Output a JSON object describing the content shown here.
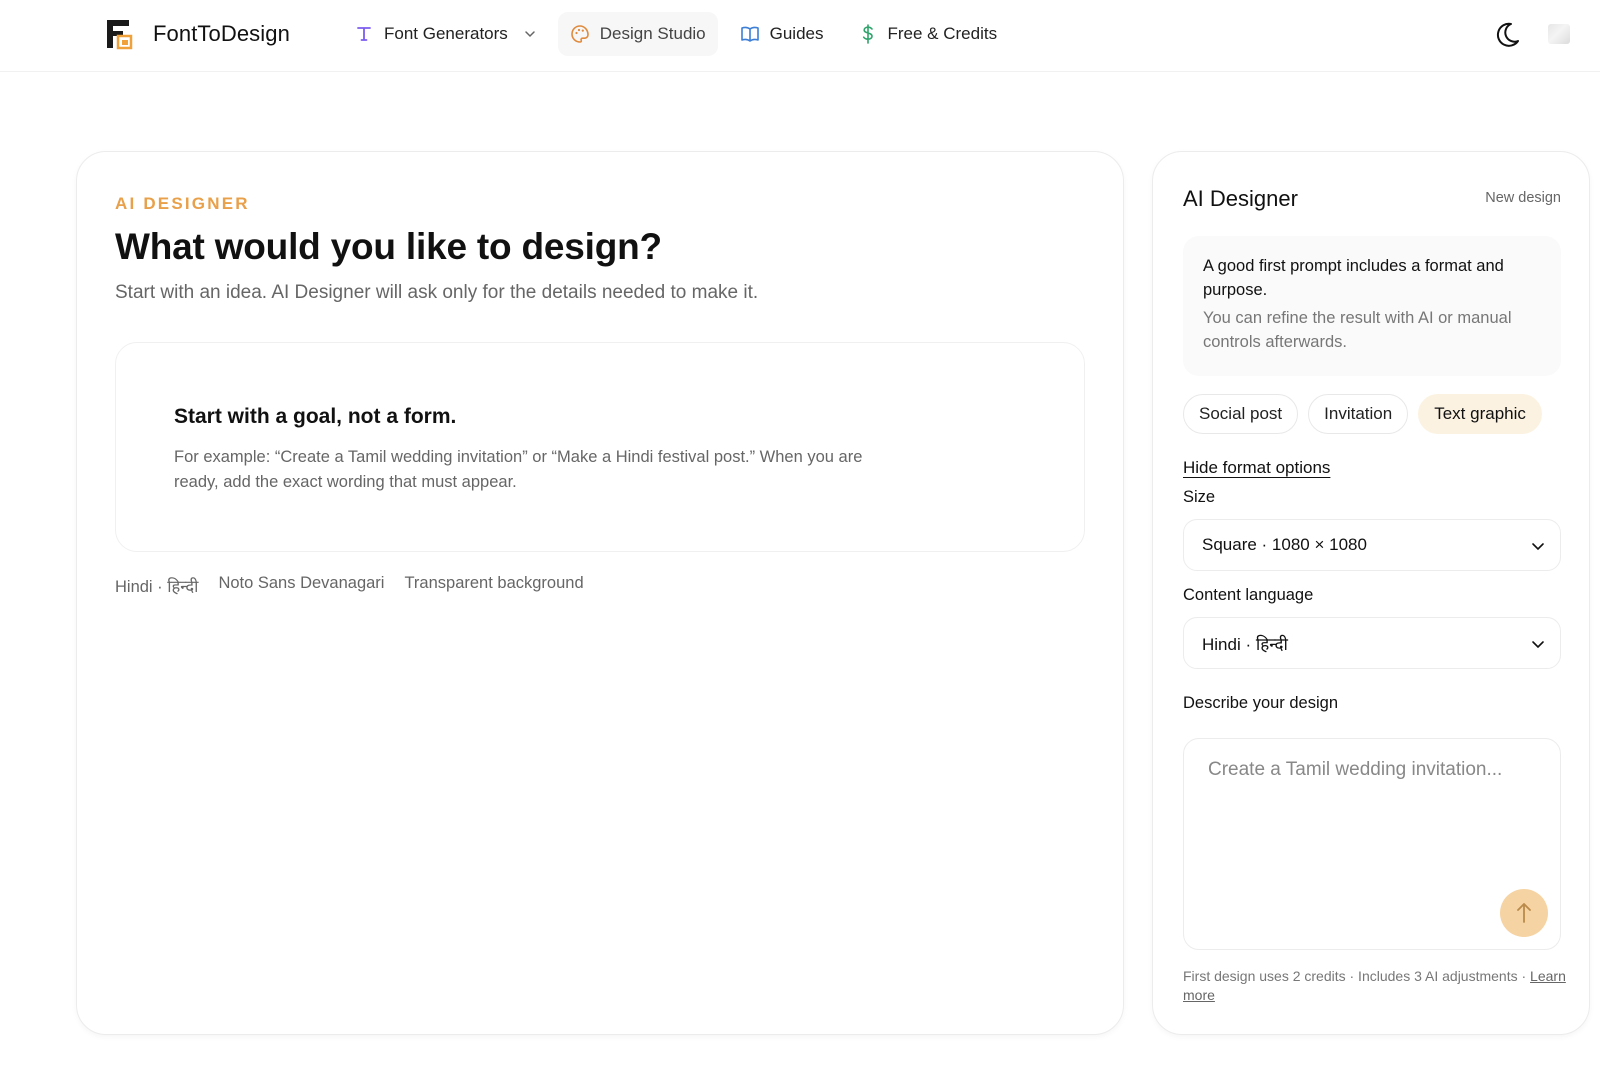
{
  "header": {
    "brand_name": "FontToDesign",
    "nav": {
      "font_generators": "Font Generators",
      "design_studio": "Design Studio",
      "guides": "Guides",
      "free_credits": "Free & Credits"
    }
  },
  "main": {
    "eyebrow": "AI DESIGNER",
    "headline": "What would you like to design?",
    "subhead": "Start with an idea. AI Designer will ask only for the details needed to make it.",
    "goal": {
      "title": "Start with a goal, not a form.",
      "text": "For example: “Create a Tamil wedding invitation” or “Make a Hindi festival post.” When you are ready, add the exact wording that must appear."
    },
    "meta": {
      "language": "Hindi · हिन्दी",
      "font": "Noto Sans Devanagari",
      "background": "Transparent background"
    }
  },
  "panel": {
    "title": "AI Designer",
    "new_design": "New design",
    "tip_strong": "A good first prompt includes a format and purpose.",
    "tip_sub": "You can refine the result with AI or manual controls afterwards.",
    "chips": {
      "social_post": "Social post",
      "invitation": "Invitation",
      "text_graphic": "Text graphic"
    },
    "hide_options": "Hide format options",
    "size_label": "Size",
    "size_value": "Square · 1080 × 1080",
    "language_label": "Content language",
    "language_value": "Hindi · हिन्दी",
    "describe_label": "Describe your design",
    "describe_placeholder": "Create a Tamil wedding invitation...",
    "footnote": "First design uses 2 credits · Includes 3 AI adjustments · ",
    "learn_more": "Learn more"
  },
  "colors": {
    "accent": "#e8a04a",
    "chip_selected": "#fbf2e1",
    "send_button": "#f6d3a2",
    "nav_icon_font_generators": "#7b5cf0",
    "nav_icon_design_studio": "#e08a3c",
    "nav_icon_guides": "#3d7fd6",
    "nav_icon_credits": "#2fa36b"
  },
  "icons": {
    "logo": "fonttodesign-logo",
    "font_generators": "type-icon",
    "design_studio": "palette-icon",
    "guides": "book-icon",
    "credits": "dollar-icon",
    "theme": "moon-icon",
    "send": "arrow-up-icon"
  }
}
